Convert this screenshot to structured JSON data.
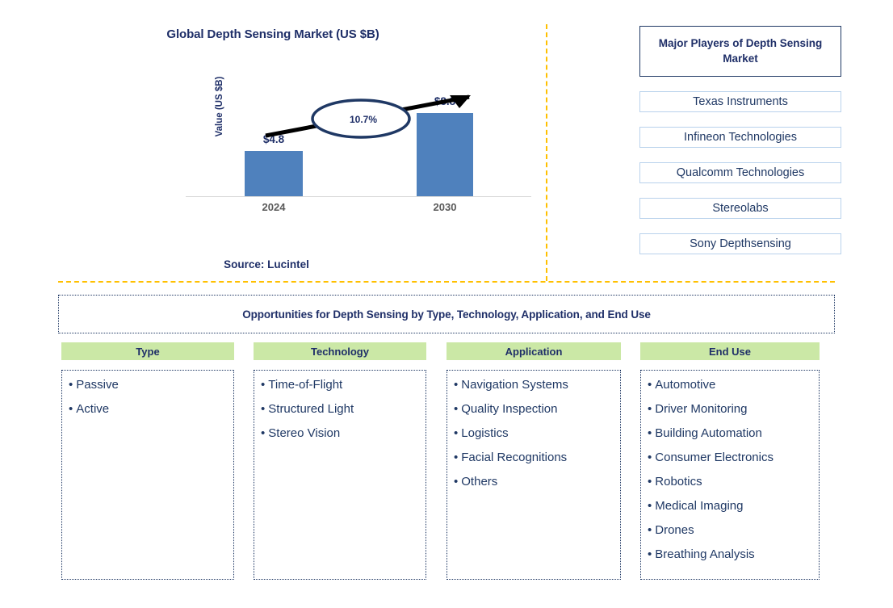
{
  "chart_panel": {
    "title": "Global Depth Sensing Market (US $B)",
    "y_axis_label": "Value (US $B)",
    "cagr_label": "10.7%",
    "source": "Source: Lucintel"
  },
  "chart_data": {
    "type": "bar",
    "title": "Global Depth Sensing Market (US $B)",
    "xlabel": "",
    "ylabel": "Value (US $B)",
    "categories": [
      "2024",
      "2030"
    ],
    "values": [
      4.8,
      8.8
    ],
    "value_labels": [
      "$4.8",
      "$8.8"
    ],
    "ylim": [
      0,
      9.5
    ],
    "grid": false,
    "legend": "none",
    "bar_color": "#4f81bd",
    "annotations": [
      {
        "text": "10.7%",
        "type": "cagr-ellipse-with-arrow",
        "from": "2024",
        "to": "2030"
      }
    ],
    "source": "Source: Lucintel"
  },
  "players": {
    "header": "Major Players of Depth Sensing Market",
    "items": [
      "Texas Instruments",
      "Infineon Technologies",
      "Qualcomm Technologies",
      "Stereolabs",
      "Sony Depthsensing"
    ]
  },
  "opportunities": {
    "banner": "Opportunities for Depth Sensing by Type, Technology, Application, and End Use",
    "columns": [
      {
        "header": "Type",
        "items": [
          "Passive",
          "Active"
        ]
      },
      {
        "header": "Technology",
        "items": [
          "Time-of-Flight",
          "Structured Light",
          "Stereo Vision"
        ]
      },
      {
        "header": "Application",
        "items": [
          "Navigation Systems",
          "Quality Inspection",
          "Logistics",
          "Facial Recognitions",
          "Others"
        ]
      },
      {
        "header": "End Use",
        "items": [
          "Automotive",
          "Driver Monitoring",
          "Building Automation",
          "Consumer Electronics",
          "Robotics",
          "Medical Imaging",
          "Drones",
          "Breathing Analysis"
        ]
      }
    ]
  },
  "colors": {
    "navy": "#1f3864",
    "bar_blue": "#4f81bd",
    "divider_gold": "#ffc000",
    "header_green": "#cbe8a6",
    "player_border": "#b9d2ec"
  }
}
